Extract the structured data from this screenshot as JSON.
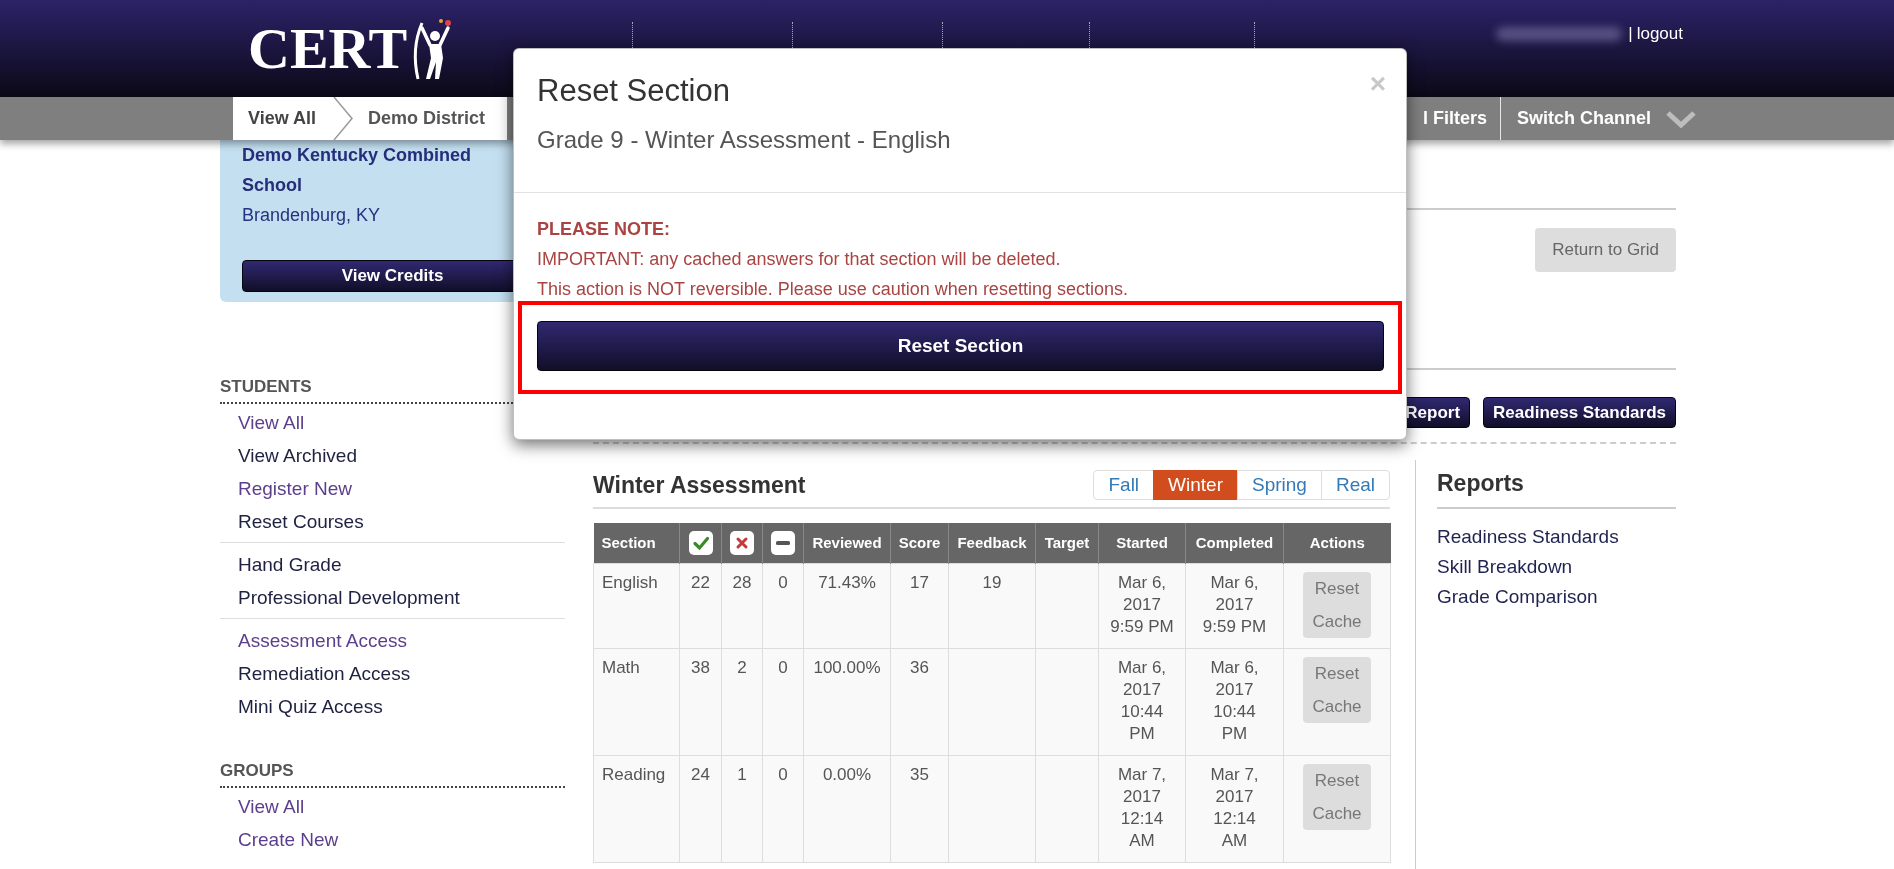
{
  "header": {
    "logo": "CERT",
    "user": {
      "separator": "|",
      "logout": "logout"
    }
  },
  "breadcrumb": {
    "items": [
      "View All",
      "Demo District"
    ],
    "filters": "l Filters",
    "channel": "Switch Channel"
  },
  "sidebar": {
    "school": {
      "name": "Demo Kentucky Combined School",
      "location": "Brandenburg, KY",
      "button": "View Credits"
    },
    "sections": [
      {
        "heading": "STUDENTS",
        "groups": [
          {
            "items": [
              {
                "label": "View All",
                "visited": true
              },
              {
                "label": "View Archived",
                "visited": false
              },
              {
                "label": "Register New",
                "visited": true
              },
              {
                "label": "Reset Courses",
                "visited": false
              }
            ]
          },
          {
            "items": [
              {
                "label": "Hand Grade",
                "visited": false
              },
              {
                "label": "Professional Development",
                "visited": false
              }
            ]
          },
          {
            "items": [
              {
                "label": "Assessment Access",
                "visited": true
              },
              {
                "label": "Remediation Access",
                "visited": false
              },
              {
                "label": "Mini Quiz Access",
                "visited": false
              }
            ]
          }
        ]
      },
      {
        "heading": "GROUPS",
        "groups": [
          {
            "items": [
              {
                "label": "View All",
                "visited": true
              },
              {
                "label": "Create New",
                "visited": true
              }
            ]
          }
        ]
      }
    ]
  },
  "toolbar": {
    "return_button": "Return to Grid",
    "report_buttons": [
      "Report",
      "Readiness Standards"
    ]
  },
  "assessment": {
    "title": "Winter Assessment",
    "terms": [
      {
        "label": "Fall",
        "selected": false
      },
      {
        "label": "Winter",
        "selected": true
      },
      {
        "label": "Spring",
        "selected": false
      },
      {
        "label": "Real",
        "selected": false
      }
    ],
    "table": {
      "columns": [
        {
          "kind": "text",
          "label": "Section"
        },
        {
          "kind": "check"
        },
        {
          "kind": "cross"
        },
        {
          "kind": "dash"
        },
        {
          "kind": "text",
          "label": "Reviewed"
        },
        {
          "kind": "text",
          "label": "Score"
        },
        {
          "kind": "text",
          "label": "Feedback"
        },
        {
          "kind": "text",
          "label": "Target"
        },
        {
          "kind": "text",
          "label": "Started"
        },
        {
          "kind": "text",
          "label": "Completed"
        },
        {
          "kind": "text",
          "label": "Actions"
        }
      ],
      "rows": [
        {
          "cells": [
            {
              "kind": "text",
              "text": "English"
            },
            {
              "kind": "text",
              "text": "22"
            },
            {
              "kind": "text",
              "text": "28"
            },
            {
              "kind": "text",
              "text": "0"
            },
            {
              "kind": "text",
              "text": "71.43%"
            },
            {
              "kind": "text",
              "text": "17"
            },
            {
              "kind": "text",
              "text": "19"
            },
            {
              "kind": "empty"
            },
            {
              "kind": "text",
              "text": "Mar 6, 2017 9:59 PM"
            },
            {
              "kind": "text",
              "text": "Mar 6, 2017 9:59 PM"
            },
            {
              "kind": "button",
              "text": "Reset Cache"
            }
          ]
        },
        {
          "cells": [
            {
              "kind": "text",
              "text": "Math"
            },
            {
              "kind": "text",
              "text": "38"
            },
            {
              "kind": "text",
              "text": "2"
            },
            {
              "kind": "text",
              "text": "0"
            },
            {
              "kind": "text",
              "text": "100.00%"
            },
            {
              "kind": "text",
              "text": "36"
            },
            {
              "kind": "empty"
            },
            {
              "kind": "empty"
            },
            {
              "kind": "text",
              "text": "Mar 6, 2017 10:44 PM"
            },
            {
              "kind": "text",
              "text": "Mar 6, 2017 10:44 PM"
            },
            {
              "kind": "button",
              "text": "Reset Cache"
            }
          ]
        },
        {
          "cells": [
            {
              "kind": "text",
              "text": "Reading"
            },
            {
              "kind": "text",
              "text": "24"
            },
            {
              "kind": "text",
              "text": "1"
            },
            {
              "kind": "text",
              "text": "0"
            },
            {
              "kind": "text",
              "text": "0.00%"
            },
            {
              "kind": "text",
              "text": "35"
            },
            {
              "kind": "empty"
            },
            {
              "kind": "empty"
            },
            {
              "kind": "text",
              "text": "Mar 7, 2017 12:14 AM"
            },
            {
              "kind": "text",
              "text": "Mar 7, 2017 12:14 AM"
            },
            {
              "kind": "button",
              "text": "Reset Cache"
            }
          ]
        }
      ]
    }
  },
  "reports": {
    "title": "Reports",
    "links": [
      "Readiness Standards",
      "Skill Breakdown",
      "Grade Comparison"
    ]
  },
  "modal": {
    "title": "Reset Section",
    "subtitle": "Grade 9 - Winter Assessment - English",
    "close": "×",
    "note_heading": "PLEASE NOTE:",
    "note_lines": [
      "IMPORTANT: any cached answers for that section will be deleted.",
      "This action is NOT reversible. Please use caution when resetting sections."
    ],
    "confirm_button": {
      "label": "Reset Section",
      "highlighted": true
    }
  }
}
